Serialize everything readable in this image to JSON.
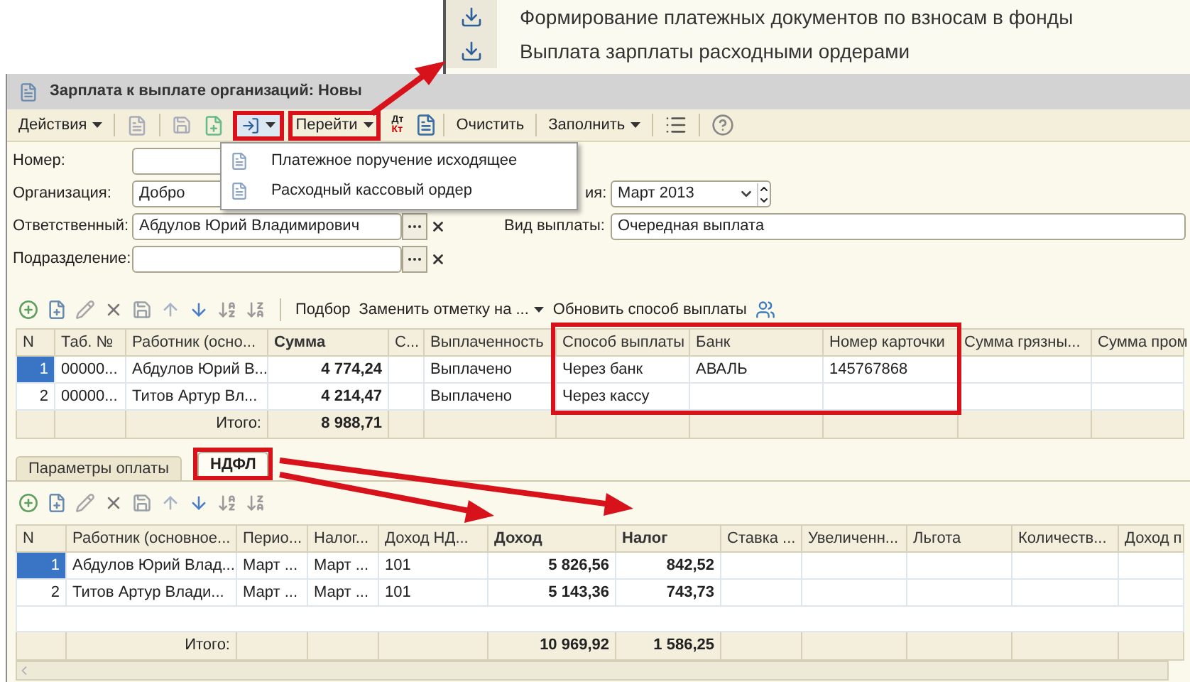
{
  "callout": {
    "items": [
      {
        "label": "Формирование платежных документов по взносам в фонды"
      },
      {
        "label": "Выплата зарплаты расходными ордерами"
      }
    ]
  },
  "window": {
    "title": "Зарплата к выплате организаций: Новы"
  },
  "toolbar": {
    "actions": "Действия",
    "goto": "Перейти",
    "dt": "Дт",
    "kt": "Кт",
    "clear": "Очистить",
    "fill": "Заполнить"
  },
  "dropdown": {
    "items": [
      {
        "label": "Платежное поручение исходящее"
      },
      {
        "label": "Расходный кассовый ордер"
      }
    ]
  },
  "form": {
    "number_label": "Номер:",
    "org_label": "Организация:",
    "org_value": "Добро",
    "period_label_part": "ия:",
    "period_value": "Март 2013",
    "responsible_label": "Ответственный:",
    "responsible_value": "Абдулов Юрий Владимирович",
    "payment_type_label": "Вид выплаты:",
    "payment_type_value": "Очередная выплата",
    "department_label": "Подразделение:"
  },
  "table_toolbar": {
    "pick": "Подбор",
    "replace": "Заменить отметку на ...",
    "refresh": "Обновить способ выплаты"
  },
  "payments_table": {
    "columns": [
      "N",
      "Таб. №",
      "Работник (осно...",
      "Сумма",
      "С...",
      "Выплаченность",
      "Способ выплаты",
      "Банк",
      "Номер карточки",
      "Сумма грязны...",
      "Сумма пром"
    ],
    "rows": [
      {
        "cells": [
          "1",
          "00000...",
          "Абдулов Юрий В...",
          "4 774,24",
          null,
          "Выплачено",
          "Через банк",
          "АВАЛЬ",
          "145767868"
        ],
        "selected": true
      },
      {
        "cells": [
          "2",
          "00000...",
          "Титов Артур Вл...",
          "4 214,47",
          null,
          "Выплачено",
          "Через кассу"
        ],
        "selected": false
      }
    ],
    "footer": {
      "label": "Итого:",
      "totals": [
        "8 988,71"
      ]
    }
  },
  "tabs": [
    {
      "label": "Параметры оплаты",
      "selected": false
    },
    {
      "label": "НДФЛ",
      "selected": true
    }
  ],
  "ndfl_table": {
    "columns": [
      "N",
      "Работник (основное...",
      "Перио...",
      "Налог...",
      "Доход НД...",
      "Доход",
      "Налог",
      "Ставка ...",
      "Увеличенн...",
      "Льгота",
      "Количеств...",
      "Доход п"
    ],
    "rows": [
      {
        "cells": [
          "1",
          "Абдулов Юрий Влад...",
          "Март ...",
          "Март ...",
          "101",
          "5 826,56",
          "842,52"
        ],
        "selected": true
      },
      {
        "cells": [
          "2",
          "Титов Артур Влади...",
          "Март ...",
          "Март ...",
          "101",
          "5 143,36",
          "743,73"
        ],
        "selected": false
      }
    ],
    "footer": {
      "label": "Итого:",
      "totals": [
        "10 969,92",
        "1 586,25"
      ]
    }
  }
}
